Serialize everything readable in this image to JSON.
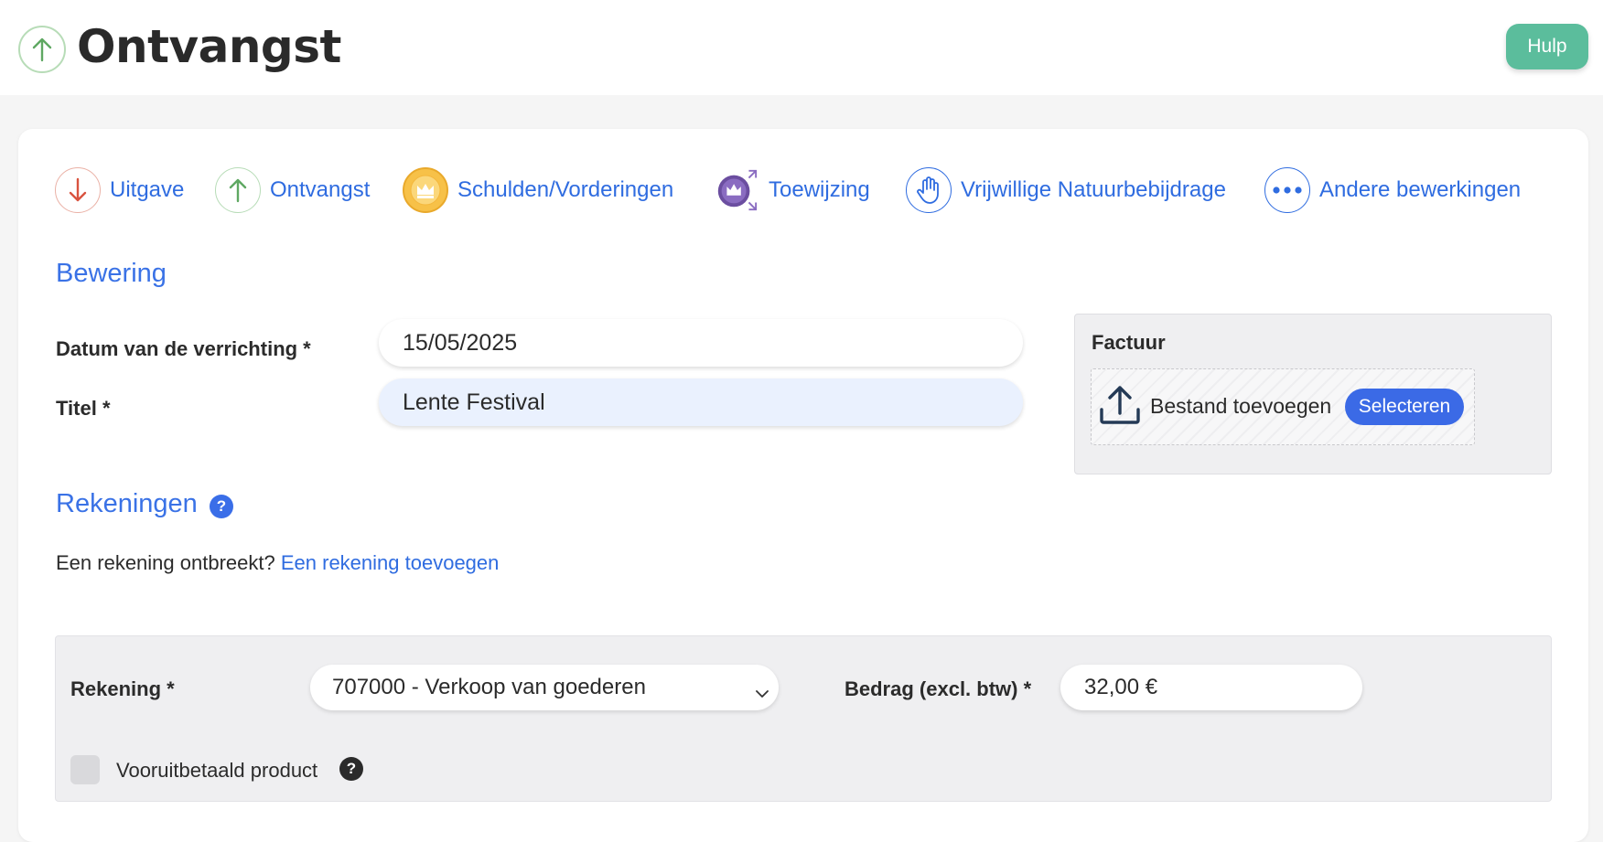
{
  "header": {
    "title": "Ontvangst",
    "title_icon": "arrow-up-icon",
    "help_label": "Hulp"
  },
  "operations": [
    {
      "label": "Uitgave",
      "icon": "arrow-down-icon",
      "color": "#d9533f"
    },
    {
      "label": "Ontvangst",
      "icon": "arrow-up-icon",
      "color": "#5fa862"
    },
    {
      "label": "Schulden/Vorderingen",
      "icon": "crown-icon",
      "color": "#f2b53a"
    },
    {
      "label": "Toewijzing",
      "icon": "crown-arrows-icon",
      "color": "#6a4a9c"
    },
    {
      "label": "Vrijwillige Natuurbebijdrage",
      "icon": "hand-icon",
      "color": "#2f6ce0"
    },
    {
      "label": "Andere bewerkingen",
      "icon": "dots-icon",
      "color": "#2f6ce0"
    }
  ],
  "statement": {
    "section_title": "Bewering",
    "date_label": "Datum van de verrichting *",
    "date_value": "15/05/2025",
    "title_label": "Titel *",
    "title_value": "Lente Festival"
  },
  "invoice": {
    "label": "Factuur",
    "upload_icon": "upload-icon",
    "add_file_text": "Bestand toevoegen",
    "select_label": "Selecteren"
  },
  "accounts": {
    "section_title": "Rekeningen",
    "help_icon": "question-icon",
    "missing_text": "Een rekening ontbreekt?",
    "add_link": "Een rekening toevoegen",
    "account_label": "Rekening *",
    "account_value": "707000 - Verkoop van goederen",
    "amount_label": "Bedrag (excl. btw) *",
    "amount_value": "32,00 €",
    "prepaid_label": "Vooruitbetaald product",
    "prepaid_checked": false
  },
  "colors": {
    "accent_blue": "#2f6ce0",
    "help_green": "#5bbd9c",
    "select_blue": "#3b6ae6"
  }
}
